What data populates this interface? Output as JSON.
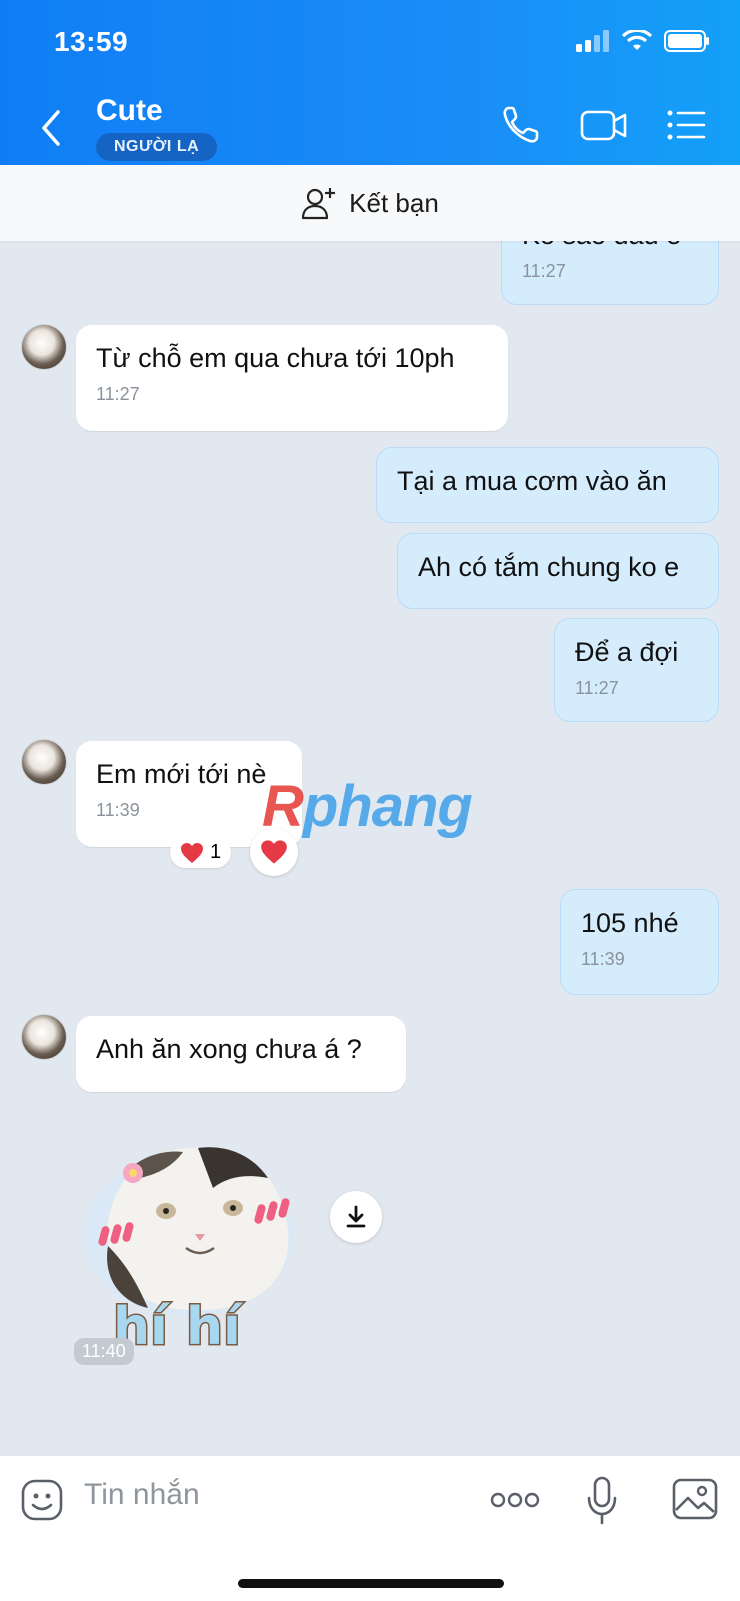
{
  "status_bar": {
    "time": "13:59"
  },
  "header": {
    "contact_name": "Cute",
    "badge": "NGƯỜI LẠ"
  },
  "add_friend": {
    "label": "Kết bạn"
  },
  "messages": [
    {
      "text": "Ko sao đâu e",
      "time": "11:27"
    },
    {
      "text": "Từ chỗ em qua chưa tới 10ph",
      "time": "11:27"
    },
    {
      "text": "Tại a mua cơm vào ăn"
    },
    {
      "text": "Ah có tắm chung ko e"
    },
    {
      "text": "Để a đợi",
      "time": "11:27"
    },
    {
      "text": "Em mới tới nè",
      "time": "11:39",
      "reaction_count": "1"
    },
    {
      "text": "105 nhé",
      "time": "11:39"
    },
    {
      "text": "Anh ăn xong chưa á ?"
    }
  ],
  "sticker": {
    "caption": "hí hí",
    "time": "11:40"
  },
  "watermark": {
    "first": "R",
    "rest": "phang"
  },
  "input": {
    "placeholder": "Tin nhắn"
  },
  "icons": [
    "back-arrow-icon",
    "phone-icon",
    "video-icon",
    "menu-icon",
    "add-person-icon",
    "heart-icon",
    "download-icon",
    "emoji-icon",
    "more-icon",
    "mic-icon",
    "image-icon"
  ]
}
